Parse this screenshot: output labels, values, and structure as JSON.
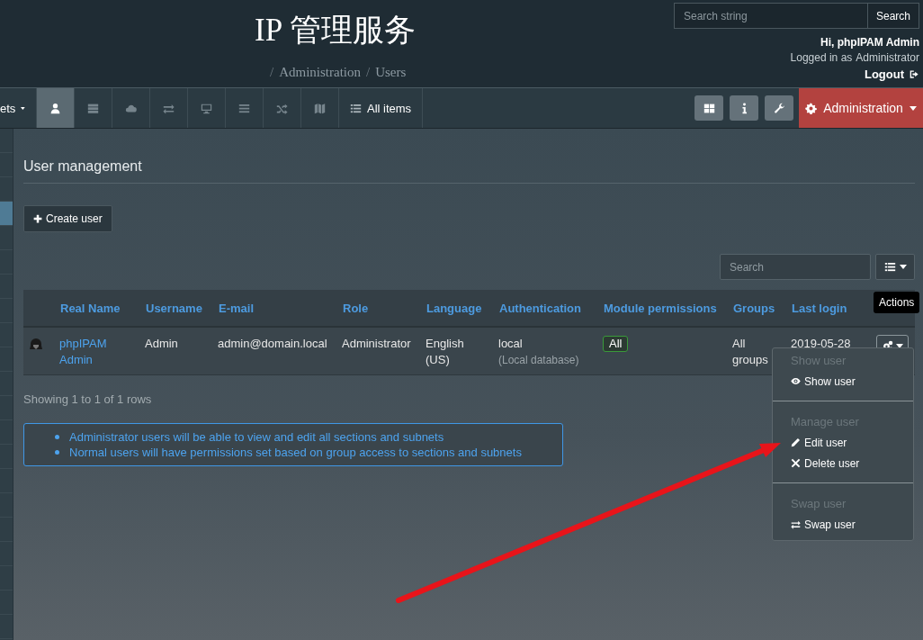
{
  "header": {
    "title": "IP 管理服务",
    "breadcrumb": [
      {
        "separator": "/",
        "label": "Administration"
      },
      {
        "separator": "/",
        "label": "Users"
      }
    ],
    "search": {
      "placeholder": "Search string",
      "button": "Search"
    },
    "greeting": "Hi, phpIPAM Admin",
    "logged_in_label": "Logged in as",
    "logged_in_role": "Administrator",
    "logout": "Logout"
  },
  "nav": {
    "left_label": "ets",
    "icons": [
      {
        "kind": "user",
        "selected": true
      },
      {
        "kind": "server",
        "selected": false
      },
      {
        "kind": "cloud",
        "selected": false
      },
      {
        "kind": "exchange",
        "selected": false
      },
      {
        "kind": "desktop",
        "selected": false
      },
      {
        "kind": "bars",
        "selected": false
      },
      {
        "kind": "random",
        "selected": false
      },
      {
        "kind": "map",
        "selected": false
      }
    ],
    "all_items": "All items",
    "tools": [
      {
        "kind": "grid"
      },
      {
        "kind": "info"
      },
      {
        "kind": "wrench"
      }
    ],
    "admin_menu": "Administration"
  },
  "page": {
    "title": "User management",
    "create_button": "Create user",
    "table_search": {
      "placeholder": "Search"
    },
    "columns": [
      "Real Name",
      "Username",
      "E-mail",
      "Role",
      "Language",
      "Authentication",
      "Module permissions",
      "Groups",
      "Last login"
    ],
    "rows": [
      {
        "real_name": "phpIPAM Admin",
        "username": "Admin",
        "email": "admin@domain.local",
        "role": "Administrator",
        "language": "English (US)",
        "auth": "local",
        "auth_note": "(Local database)",
        "module_permissions": "All",
        "groups": "All groups",
        "last_login": "2019-05-28"
      }
    ],
    "footer": "Showing 1 to 1 of 1 rows",
    "notes": [
      "Administrator users will be able to view and edit all sections and subnets",
      "Normal users will have permissions set based on group access to sections and subnets"
    ]
  },
  "actions": {
    "tooltip": "Actions",
    "menu": [
      {
        "header": "Show user",
        "items": [
          {
            "kind": "eye",
            "label": "Show user"
          }
        ]
      },
      {
        "header": "Manage user",
        "items": [
          {
            "kind": "pencil",
            "label": "Edit user"
          },
          {
            "kind": "times",
            "label": "Delete user"
          }
        ]
      },
      {
        "header": "Swap user",
        "items": [
          {
            "kind": "exchange",
            "label": "Swap user"
          }
        ]
      }
    ]
  }
}
